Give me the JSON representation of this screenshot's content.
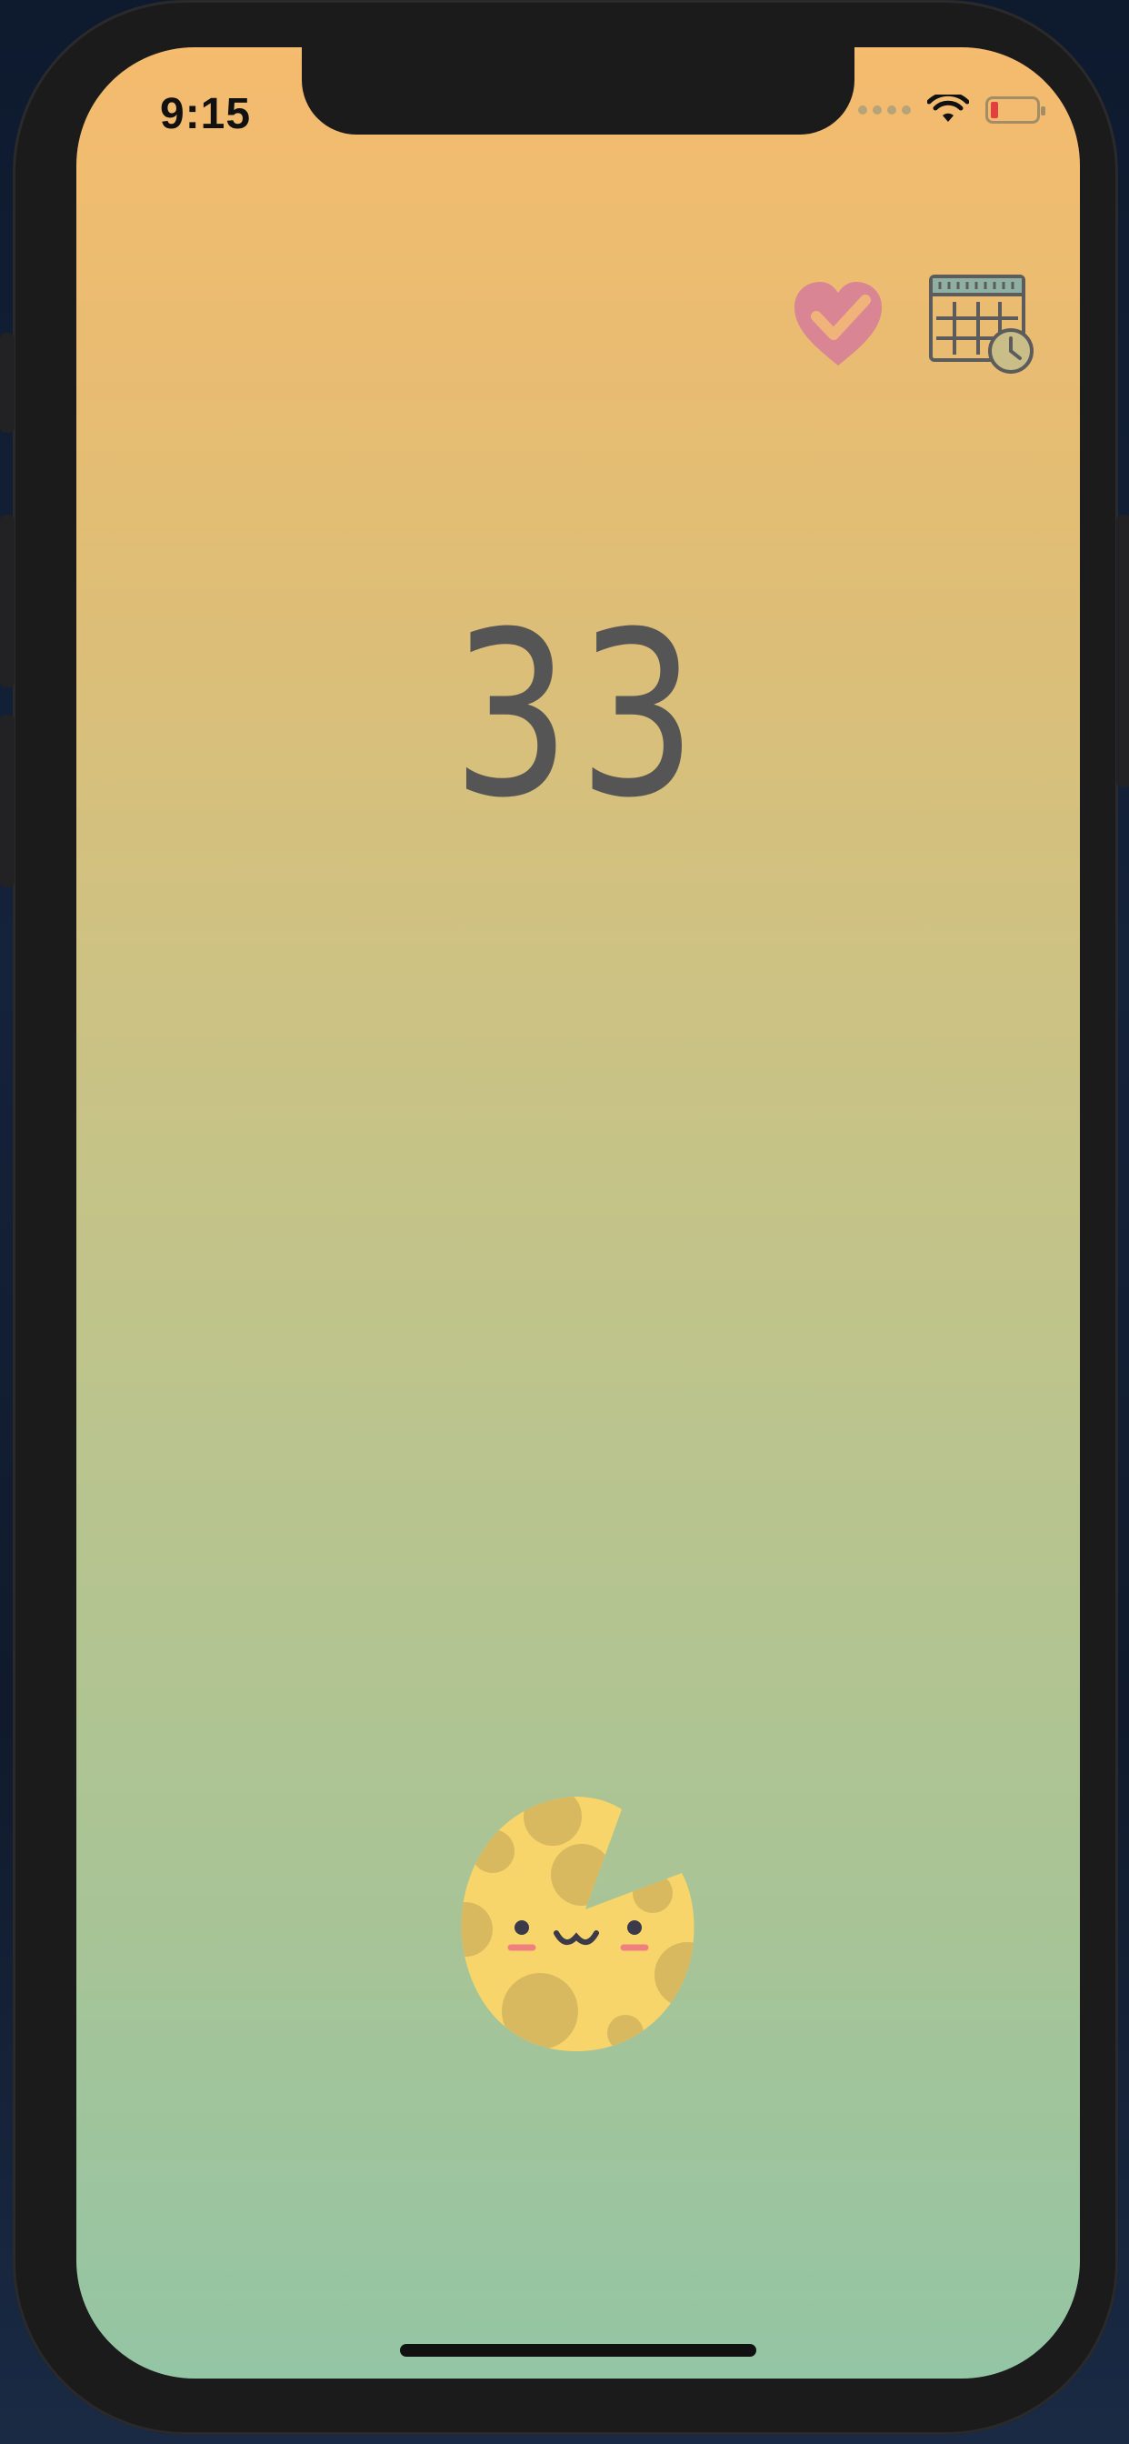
{
  "status_bar": {
    "time": "9:15"
  },
  "counter": {
    "value": "33"
  },
  "icons": {
    "favorites": "heart-check-icon",
    "schedule": "calendar-clock-icon",
    "mascot": "cheese-mascot"
  },
  "colors": {
    "gradient_top": "#f5bb6e",
    "gradient_bottom": "#94c5a4",
    "counter_text": "#555555",
    "heart": "#d98593",
    "cheese": "#f7d56a",
    "cheese_holes": "#d8b960"
  }
}
